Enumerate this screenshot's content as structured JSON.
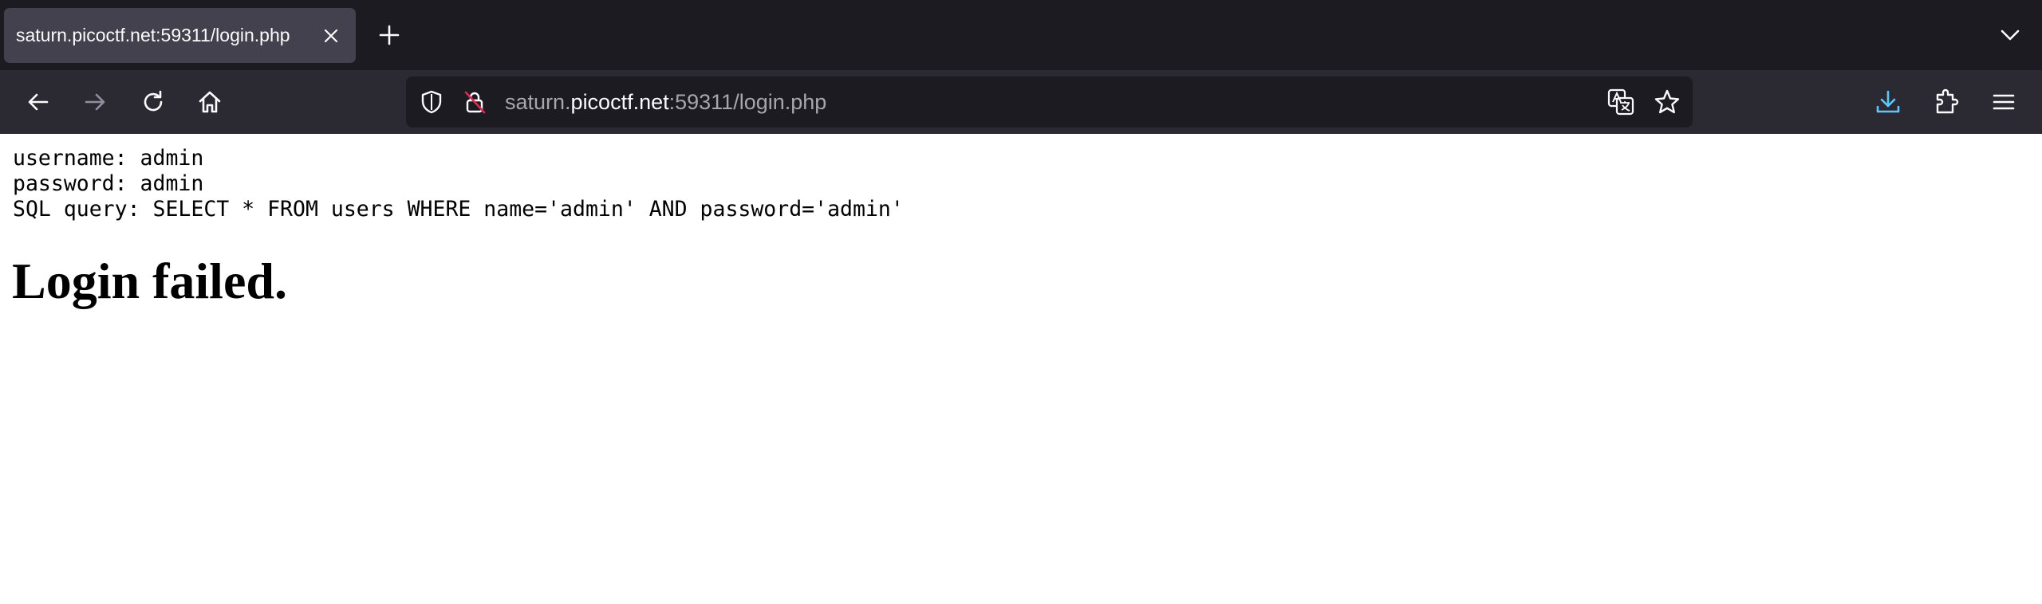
{
  "browser": {
    "tab": {
      "title": "saturn.picoctf.net:59311/login.php"
    },
    "urlbar": {
      "host_prefix": "saturn.",
      "host_domain": "picoctf.net",
      "rest": ":59311/login.php"
    },
    "icons": {
      "tab_close": "close-icon",
      "new_tab": "plus-icon",
      "tab_list": "chevron-down-icon",
      "back": "arrow-left-icon",
      "forward": "arrow-right-icon",
      "reload": "reload-icon",
      "home": "home-icon",
      "tracking": "shield-icon",
      "insecure": "lock-insecure-icon",
      "translate": "translate-icon",
      "bookmark": "star-icon",
      "downloads": "download-icon",
      "extensions": "puzzle-icon",
      "menu": "hamburger-icon"
    },
    "colors": {
      "tabstrip_bg": "#1c1b22",
      "toolbar_bg": "#2b2a33",
      "active_tab_bg": "#42414d",
      "urlbar_bg": "#1c1b22",
      "downloads_accent": "#54ffbd"
    }
  },
  "page": {
    "username_line": "username: admin",
    "password_line": "password: admin",
    "sql_line": "SQL query: SELECT * FROM users WHERE name='admin' AND password='admin'",
    "result": "Login failed."
  }
}
